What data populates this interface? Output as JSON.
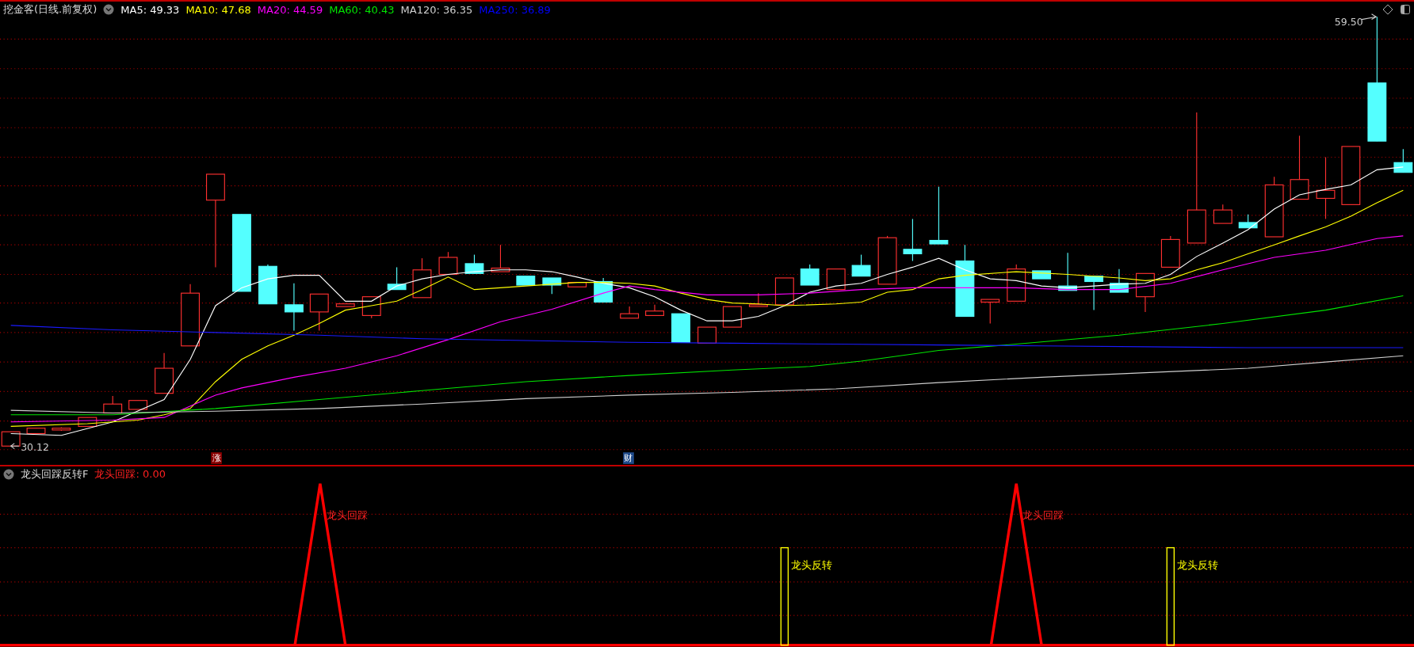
{
  "chart_header": {
    "title": "挖金客(日线.前复权)",
    "indicators": [
      {
        "label": "MA5: 49.33",
        "color": "#ffffff"
      },
      {
        "label": "MA10: 47.68",
        "color": "#ffff00"
      },
      {
        "label": "MA20: 44.59",
        "color": "#ff00ff"
      },
      {
        "label": "MA60: 40.43",
        "color": "#00e600"
      },
      {
        "label": "MA120: 36.35",
        "color": "#d0d0d0"
      },
      {
        "label": "MA250: 36.89",
        "color": "#0000ff"
      }
    ]
  },
  "price_labels": {
    "high": "59.50",
    "low": "30.12"
  },
  "event_marks": [
    {
      "label": "涨",
      "color": "#8b0000"
    },
    {
      "label": "财",
      "color": "#1e4a8a"
    }
  ],
  "indicator_panel": {
    "title": "龙头回踩反转F",
    "reading": "龙头回踩: 0.00",
    "signals": [
      {
        "kind": "pullback",
        "label": "龙头回踩"
      },
      {
        "kind": "reversal",
        "label": "龙头反转"
      },
      {
        "kind": "pullback",
        "label": "龙头回踩"
      },
      {
        "kind": "reversal",
        "label": "龙头反转"
      }
    ]
  }
}
